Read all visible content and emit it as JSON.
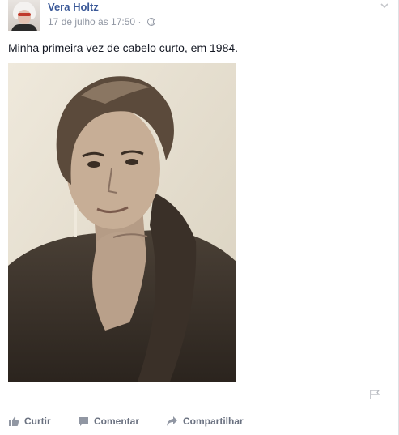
{
  "post": {
    "author": "Vera Holtz",
    "timestamp": "17 de julho às 17:50",
    "separator": "·",
    "privacy_icon": "globe-icon",
    "message": "Minha primeira vez de cabelo curto, em 1984.",
    "options_icon": "chevron-down-icon",
    "report_icon": "flag-icon"
  },
  "actions": {
    "like_label": "Curtir",
    "comment_label": "Comentar",
    "share_label": "Compartilhar"
  },
  "colors": {
    "author": "#3b5998",
    "meta": "#9197a3",
    "action": "#6a7180"
  }
}
